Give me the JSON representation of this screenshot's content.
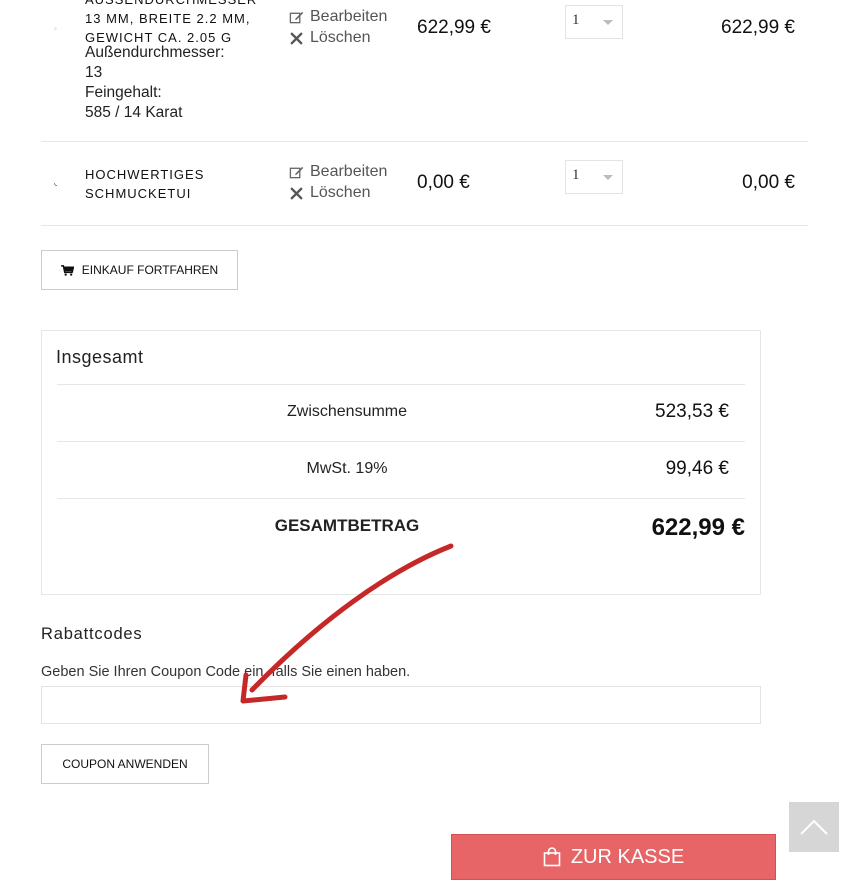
{
  "cart": {
    "items": [
      {
        "title_lines": [
          "AUSSENDURCHMESSER",
          "13 MM, BREITE 2.2 MM,",
          "GEWICHT CA. 2.05 G"
        ],
        "attributes": [
          {
            "label": "Außendurchmesser:",
            "value": "13"
          },
          {
            "label": "Feingehalt:",
            "value": "585 / 14 Karat"
          }
        ],
        "edit_label": "Bearbeiten",
        "delete_label": "Löschen",
        "price": "622,99 €",
        "quantity": "1",
        "subtotal": "622,99 €"
      },
      {
        "title_lines": [
          "HOCHWERTIGES",
          "SCHMUCKETUI"
        ],
        "edit_label": "Bearbeiten",
        "delete_label": "Löschen",
        "price": "0,00 €",
        "quantity": "1",
        "subtotal": "0,00 €"
      }
    ],
    "continue_label": "EINKAUF FORTFAHREN"
  },
  "totals": {
    "title": "Insgesamt",
    "subtotal_label": "Zwischensumme",
    "subtotal_value": "523,53 €",
    "tax_label": "MwSt. 19%",
    "tax_value": "99,46 €",
    "grand_total_label": "GESAMTBETRAG",
    "grand_total_value": "622,99 €"
  },
  "coupon": {
    "title": "Rabattcodes",
    "hint": "Geben Sie Ihren Coupon Code ein, falls Sie einen haben.",
    "input_value": "",
    "apply_label": "COUPON ANWENDEN"
  },
  "checkout": {
    "label": "ZUR KASSE"
  },
  "colors": {
    "checkout_bg": "#e76567",
    "annotation_arrow": "#c62828"
  },
  "icons": [
    "edit-icon",
    "close-icon",
    "cart-icon",
    "shopping-bag-icon",
    "chevron-up-icon"
  ]
}
